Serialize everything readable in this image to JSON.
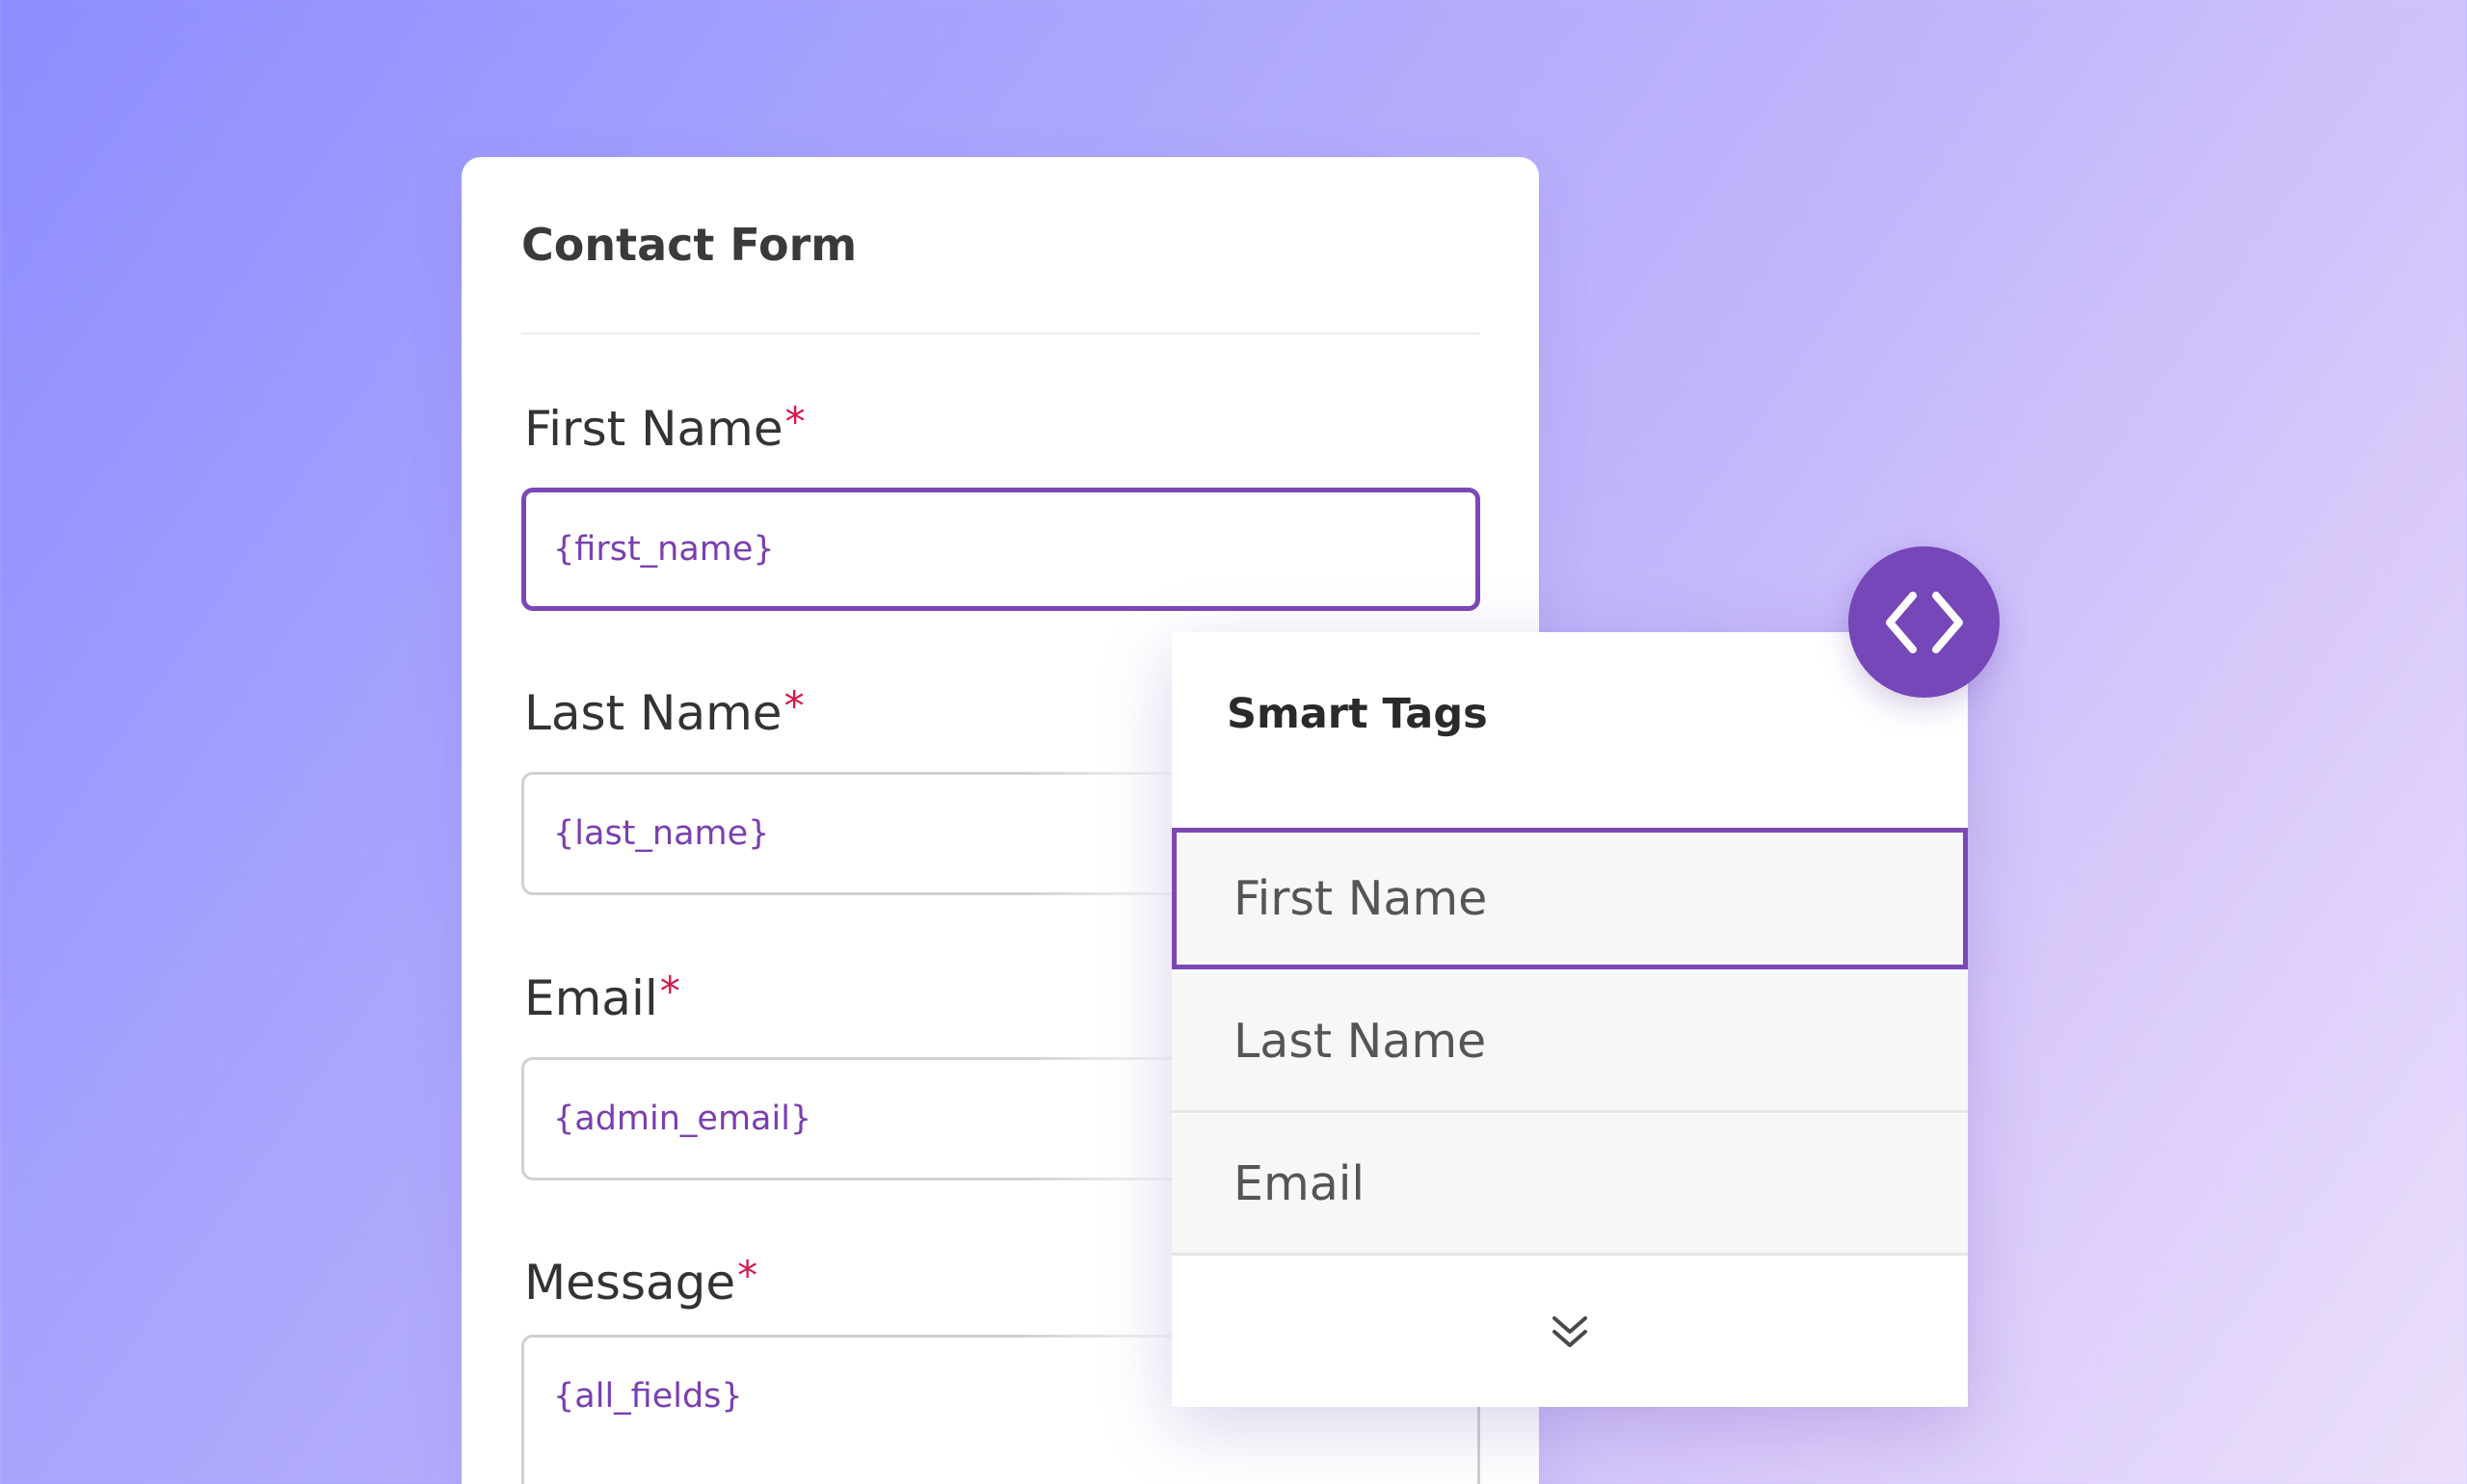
{
  "form": {
    "title": "Contact Form",
    "fields": [
      {
        "label": "First Name",
        "required_mark": "*",
        "value": "{first_name}"
      },
      {
        "label": "Last Name",
        "required_mark": "*",
        "value": "{last_name}"
      },
      {
        "label": "Email",
        "required_mark": "*",
        "value": "{admin_email}"
      },
      {
        "label": "Message",
        "required_mark": "*",
        "value": "{all_fields}"
      }
    ]
  },
  "smart_tags": {
    "title": "Smart Tags",
    "items": [
      {
        "label": "First Name",
        "selected": true
      },
      {
        "label": "Last Name",
        "selected": false
      },
      {
        "label": "Email",
        "selected": false
      }
    ],
    "more_icon": "double-chevron-down-icon"
  },
  "code_button": {
    "icon": "code-brackets-icon"
  },
  "colors": {
    "accent": "#7547b8",
    "required": "#d6194a",
    "tag_value": "#7a3fb0"
  }
}
